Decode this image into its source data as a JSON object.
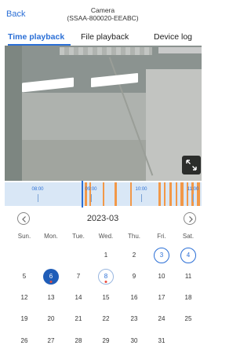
{
  "header": {
    "back_label": "Back",
    "title_line1": "Camera",
    "title_line2": "(SSAA-800020-EEABC)"
  },
  "tabs": [
    {
      "label": "Time playback",
      "active": true
    },
    {
      "label": "File playback",
      "active": false
    },
    {
      "label": "Device log",
      "active": false
    }
  ],
  "video": {
    "fullscreen_icon": "expand-icon"
  },
  "timeline": {
    "ticks": [
      "08:00",
      "09:00",
      "10:00",
      "11:00"
    ],
    "accent_color": "#2b6fd6",
    "record_color": "#f29848"
  },
  "calendar": {
    "month": "2023-03",
    "prev_icon": "chevron-left-icon",
    "next_icon": "chevron-right-icon",
    "weekdays": [
      "Sun.",
      "Mon.",
      "Tue.",
      "Wed.",
      "Thu.",
      "Fri.",
      "Sat."
    ],
    "weeks": [
      [
        "",
        "",
        "",
        "1",
        "2",
        "3",
        "4"
      ],
      [
        "5",
        "6",
        "7",
        "8",
        "9",
        "10",
        "11"
      ],
      [
        "12",
        "13",
        "14",
        "15",
        "16",
        "17",
        "18"
      ],
      [
        "19",
        "20",
        "21",
        "22",
        "23",
        "24",
        "25"
      ],
      [
        "26",
        "27",
        "28",
        "29",
        "30",
        "31",
        ""
      ]
    ],
    "recorded_days": [
      "3",
      "4"
    ],
    "selected_day": "6",
    "today": "8",
    "marked_days": [
      "6",
      "8"
    ]
  }
}
